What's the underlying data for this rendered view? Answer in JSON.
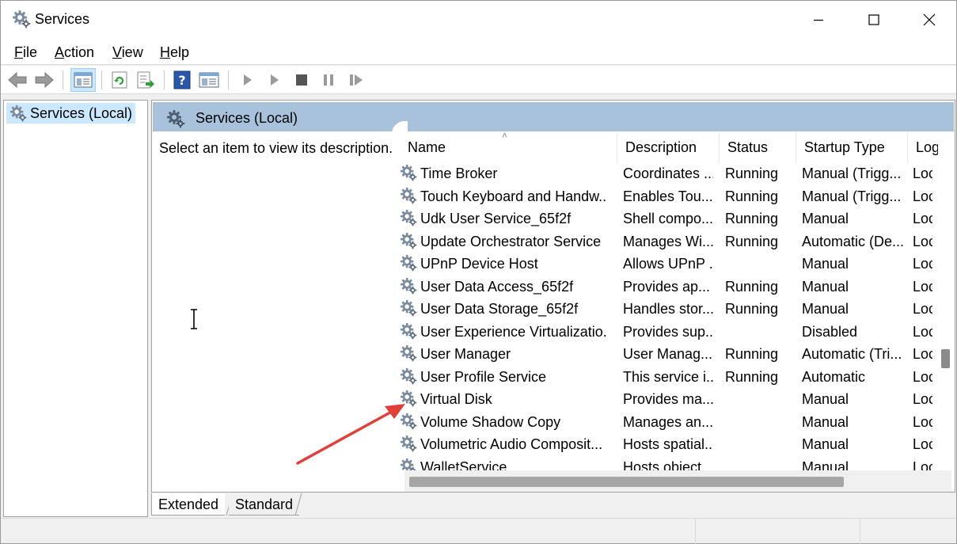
{
  "window": {
    "title": "Services",
    "icon": "services-gear-icon"
  },
  "menu": {
    "items": [
      {
        "label": "File",
        "accel": "F",
        "rest": "ile"
      },
      {
        "label": "Action",
        "accel": "A",
        "rest": "ction"
      },
      {
        "label": "View",
        "accel": "V",
        "rest": "iew"
      },
      {
        "label": "Help",
        "accel": "H",
        "rest": "elp"
      }
    ]
  },
  "toolbar": {
    "buttons": [
      "back-icon",
      "forward-icon",
      "show-hide-console-tree-icon",
      "refresh-icon",
      "export-list-icon",
      "help-icon",
      "properties-icon",
      "start-service-icon",
      "start-service-alt-icon",
      "stop-service-icon",
      "pause-service-icon",
      "restart-service-icon"
    ]
  },
  "tree": {
    "selected_label": "Services (Local)"
  },
  "right": {
    "header_title": "Services (Local)",
    "description_prompt": "Select an item to view its description."
  },
  "list": {
    "columns": [
      "Name",
      "Description",
      "Status",
      "Startup Type",
      "Log"
    ],
    "rows": [
      {
        "name": "Time Broker",
        "description": "Coordinates ...",
        "status": "Running",
        "startup": "Manual (Trigg...",
        "logon": "Loc"
      },
      {
        "name": "Touch Keyboard and Handw...",
        "description": "Enables Tou...",
        "status": "Running",
        "startup": "Manual (Trigg...",
        "logon": "Loc"
      },
      {
        "name": "Udk User Service_65f2f",
        "description": "Shell compo...",
        "status": "Running",
        "startup": "Manual",
        "logon": "Loc"
      },
      {
        "name": "Update Orchestrator Service",
        "description": "Manages Wi...",
        "status": "Running",
        "startup": "Automatic (De...",
        "logon": "Loc"
      },
      {
        "name": "UPnP Device Host",
        "description": "Allows UPnP ...",
        "status": "",
        "startup": "Manual",
        "logon": "Loc"
      },
      {
        "name": "User Data Access_65f2f",
        "description": "Provides ap...",
        "status": "Running",
        "startup": "Manual",
        "logon": "Loc"
      },
      {
        "name": "User Data Storage_65f2f",
        "description": "Handles stor...",
        "status": "Running",
        "startup": "Manual",
        "logon": "Loc"
      },
      {
        "name": "User Experience Virtualizatio...",
        "description": "Provides sup...",
        "status": "",
        "startup": "Disabled",
        "logon": "Loc"
      },
      {
        "name": "User Manager",
        "description": "User Manag...",
        "status": "Running",
        "startup": "Automatic (Tri...",
        "logon": "Loc"
      },
      {
        "name": "User Profile Service",
        "description": "This service i...",
        "status": "Running",
        "startup": "Automatic",
        "logon": "Loc"
      },
      {
        "name": "Virtual Disk",
        "description": "Provides ma...",
        "status": "",
        "startup": "Manual",
        "logon": "Loc"
      },
      {
        "name": "Volume Shadow Copy",
        "description": "Manages an...",
        "status": "",
        "startup": "Manual",
        "logon": "Loc"
      },
      {
        "name": "Volumetric Audio Composit...",
        "description": "Hosts spatial...",
        "status": "",
        "startup": "Manual",
        "logon": "Loc"
      },
      {
        "name": "WalletService",
        "description": "Hosts object...",
        "status": "",
        "startup": "Manual",
        "logon": "Loc"
      }
    ]
  },
  "scroll": {
    "vertical_position": 0.68,
    "horizontal_position": 0.0
  },
  "tabs": {
    "extended": "Extended",
    "standard": "Standard",
    "active": "Extended"
  },
  "annotation": {
    "color": "#e0403a",
    "target": "Virtual Disk"
  },
  "colors": {
    "header_bar": "#a9c2dc",
    "selection": "#cce8ff"
  }
}
